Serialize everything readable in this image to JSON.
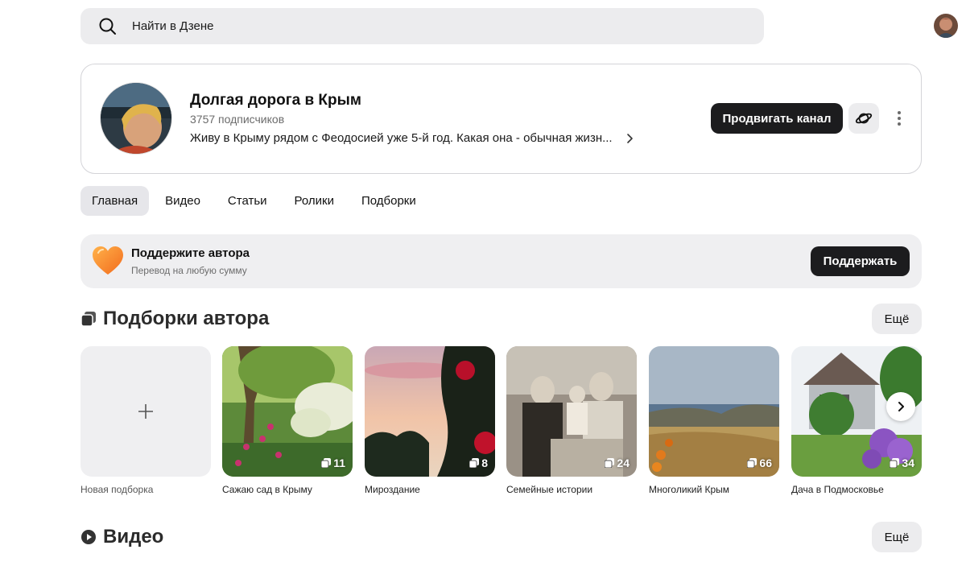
{
  "search": {
    "placeholder": "Найти в Дзене"
  },
  "channel": {
    "name": "Долгая дорога в Крым",
    "subscribers": "3757 подписчиков",
    "description": "Живу в Крыму рядом с Феодосией уже 5-й год. Какая она - обычная жизн...",
    "promote_label": "Продвигать канал"
  },
  "tabs": [
    {
      "label": "Главная",
      "active": true
    },
    {
      "label": "Видео"
    },
    {
      "label": "Статьи"
    },
    {
      "label": "Ролики"
    },
    {
      "label": "Подборки"
    }
  ],
  "support": {
    "title": "Поддержите автора",
    "subtitle": "Перевод на любую сумму",
    "button": "Поддержать"
  },
  "collections": {
    "title": "Подборки автора",
    "more_label": "Ещё",
    "new_label": "Новая подборка",
    "items": [
      {
        "title": "Сажаю сад в Крыму",
        "count": "11"
      },
      {
        "title": "Мироздание",
        "count": "8"
      },
      {
        "title": "Семейные истории",
        "count": "24"
      },
      {
        "title": "Многоликий Крым",
        "count": "66"
      },
      {
        "title": "Дача в Подмосковье",
        "count": "34"
      }
    ]
  },
  "video": {
    "title": "Видео",
    "more_label": "Ещё"
  },
  "colors": {
    "dark_button": "#1c1c1e",
    "surface": "#ececee",
    "heart_orange": "#f7931e"
  }
}
